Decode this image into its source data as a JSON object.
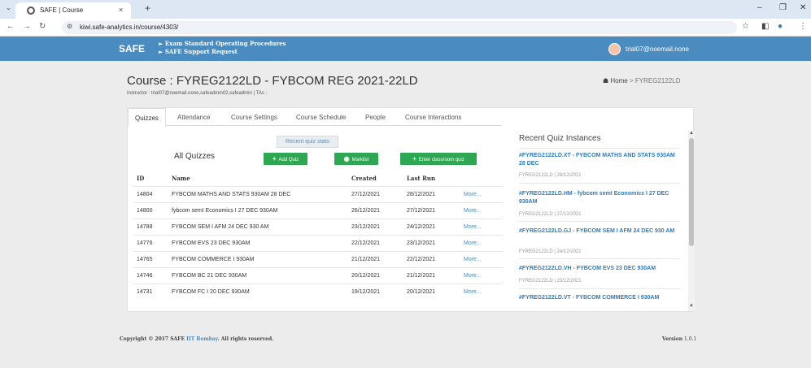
{
  "browser": {
    "tab_title": "SAFE | Course",
    "tab_close": "×",
    "new_tab": "+",
    "tab_menu": "⌄",
    "url": "kiwi.safe-analytics.in/course/4303/",
    "minimize": "–",
    "restore": "❐",
    "close": "✕"
  },
  "header": {
    "brand": "SAFE",
    "links": [
      "► Exam Standard Operating Procedures",
      "► SAFE Support Request"
    ],
    "user_email": "trial07@noemail.none"
  },
  "course": {
    "title": "Course : FYREG2122LD - FYBCOM REG 2021-22LD",
    "instructor": "Instructor : trial07@noemail.none,safeadmin02,safeadmin | TAs :",
    "breadcrumb_home": "Home",
    "breadcrumb_sep": ">",
    "breadcrumb_current": "FYREG2122LD"
  },
  "tabs": [
    "Quizzes",
    "Attendance",
    "Course Settings",
    "Course Schedule",
    "People",
    "Course Interactions"
  ],
  "quizzes": {
    "stats_button": "Recent quiz stats",
    "heading": "All Quizzes",
    "add_quiz": "Add Quiz",
    "marklist": "Marklist",
    "enter_classroom": "Enter classroom quiz",
    "columns": [
      "ID",
      "Name",
      "Created",
      "Last Run"
    ],
    "more_label": "More...",
    "rows": [
      {
        "id": "14804",
        "name": "FYBCOM MATHS AND STATS 930AM 28 DEC",
        "created": "27/12/2021",
        "last_run": "28/12/2021"
      },
      {
        "id": "14800",
        "name": "fybcom semI Economics I 27 DEC 930AM",
        "created": "26/12/2021",
        "last_run": "27/12/2021"
      },
      {
        "id": "14788",
        "name": "FYBCOM SEM I AFM 24 DEC 930 AM",
        "created": "23/12/2021",
        "last_run": "24/12/2021"
      },
      {
        "id": "14776",
        "name": "FYBCOM EVS 23 DEC 930AM",
        "created": "22/12/2021",
        "last_run": "23/12/2021"
      },
      {
        "id": "14765",
        "name": "FYBCOM COMMERCE I 930AM",
        "created": "21/12/2021",
        "last_run": "22/12/2021"
      },
      {
        "id": "14746",
        "name": "FYBCOM BC 21 DEC 930AM",
        "created": "20/12/2021",
        "last_run": "21/12/2021"
      },
      {
        "id": "14731",
        "name": "FYBCOM FC I 20 DEC 930AM",
        "created": "19/12/2021",
        "last_run": "20/12/2021"
      }
    ]
  },
  "recent": {
    "title": "Recent Quiz Instances",
    "items": [
      {
        "link": "#FYREG2122LD.XT - FYBCOM MATHS AND STATS 930AM 28 DEC",
        "meta": "FYREG2122LD | 28/12/2021"
      },
      {
        "link": "#FYREG2122LD.HM - fybcom semI Economics I 27 DEC 930AM",
        "meta": "FYREG2122LD | 27/12/2021"
      },
      {
        "link": "#FYREG2122LD.GJ - FYBCOM SEM I AFM 24 DEC 930 AM",
        "meta": "FYREG2122LD | 24/12/2021"
      },
      {
        "link": "#FYREG2122LD.VH - FYBCOM EVS 23 DEC 930AM",
        "meta": "FYREG2122LD | 23/12/2021"
      },
      {
        "link": "#FYREG2122LD.VT - FYBCOM COMMERCE I 930AM",
        "meta": ""
      }
    ]
  },
  "footer": {
    "copyright_pre": "Copyright © 2017 SAFE",
    "org": "IIT Bombay",
    "copyright_post": ". All rights reserved.",
    "version_label": "Version",
    "version": "1.0.1"
  },
  "colors": {
    "header": "#4a8bc0",
    "green_button": "#2ea652",
    "link": "#2f7bbd"
  }
}
